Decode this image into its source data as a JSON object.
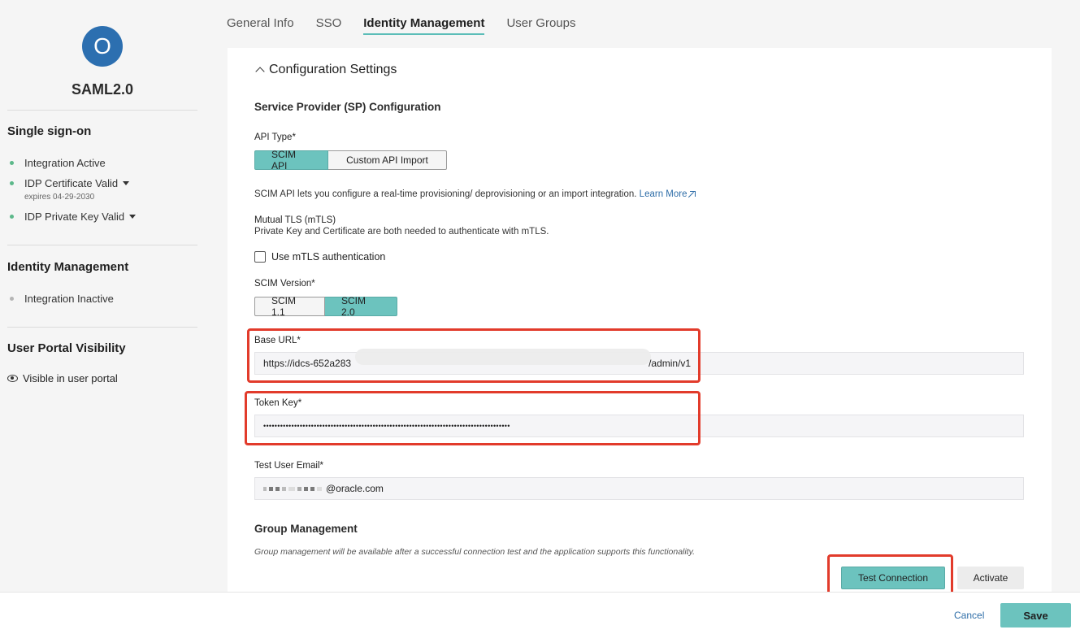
{
  "app": {
    "avatar_letter": "O",
    "name": "SAML2.0"
  },
  "sidebar": {
    "single_sign_on": {
      "title": "Single sign-on",
      "items": [
        {
          "label": "Integration Active",
          "dot_color": "#5cb88a"
        },
        {
          "label": "IDP Certificate Valid",
          "dot_color": "#5cb88a",
          "sub": "expires 04-29-2030"
        },
        {
          "label": "IDP Private Key Valid",
          "dot_color": "#5cb88a"
        }
      ]
    },
    "identity_management": {
      "title": "Identity Management",
      "items": [
        {
          "label": "Integration Inactive",
          "dot_color": "#b5b5b5"
        }
      ]
    },
    "user_portal": {
      "title": "User Portal Visibility",
      "visibility": "Visible in user portal"
    }
  },
  "tabs": [
    {
      "label": "General Info"
    },
    {
      "label": "SSO"
    },
    {
      "label": "Identity Management",
      "active": true
    },
    {
      "label": "User Groups"
    }
  ],
  "config": {
    "title": "Configuration Settings",
    "sp_title": "Service Provider (SP) Configuration",
    "api_type": {
      "label": "API Type*",
      "options": [
        "SCIM API",
        "Custom API Import"
      ],
      "selected": "SCIM API"
    },
    "api_description": "SCIM API lets you configure a real-time provisioning/ deprovisioning or an import integration.",
    "learn_more": "Learn More",
    "mtls": {
      "title": "Mutual TLS (mTLS)",
      "description": "Private Key and Certificate are both needed to authenticate with mTLS.",
      "checkbox_label": "Use mTLS authentication"
    },
    "scim_version": {
      "label": "SCIM Version*",
      "options": [
        "SCIM 1.1",
        "SCIM 2.0"
      ],
      "selected": "SCIM 2.0"
    },
    "base_url": {
      "label": "Base URL*",
      "value_start": "https://idcs-652a283",
      "value_end": "/admin/v1"
    },
    "token_key": {
      "label": "Token Key*",
      "value": "••••••••••••••••••••••••••••••••••••••••••••••••••••••••••••••••••••••••••••••••••••••••"
    },
    "test_email": {
      "label": "Test User Email*",
      "domain": "@oracle.com"
    },
    "group_management": {
      "title": "Group Management",
      "note": "Group management will be available after a successful connection test and the application supports this functionality."
    },
    "buttons": {
      "test": "Test Connection",
      "activate": "Activate"
    }
  },
  "footer": {
    "cancel": "Cancel",
    "save": "Save"
  },
  "colors": {
    "accent": "#6cc3be",
    "highlight": "#e23b2b",
    "link": "#2f6ea8",
    "avatar": "#2c6fb0"
  }
}
